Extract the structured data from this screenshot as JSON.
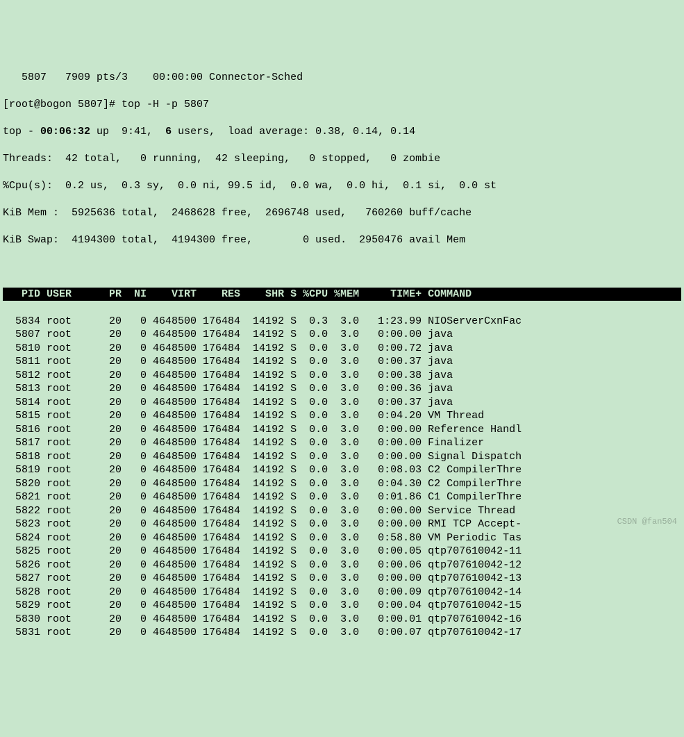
{
  "pre": {
    "ps_line": "   5807   7909 pts/3    00:00:00 Connector-Sched",
    "prompt": "[root@bogon 5807]# ",
    "command": "top -H -p 5807"
  },
  "summary": {
    "l1_a": "top - ",
    "l1_time": "00:06:32",
    "l1_b": " up  9:41,  ",
    "l1_users": "6",
    "l1_c": " users,  load average: 0.38, 0.14, 0.14",
    "l2": "Threads:  42 total,   0 running,  42 sleeping,   0 stopped,   0 zombie",
    "l3": "%Cpu(s):  0.2 us,  0.3 sy,  0.0 ni, 99.5 id,  0.0 wa,  0.0 hi,  0.1 si,  0.0 st",
    "l4": "KiB Mem :  5925636 total,  2468628 free,  2696748 used,   760260 buff/cache",
    "l5": "KiB Swap:  4194300 total,  4194300 free,        0 used.  2950476 avail Mem "
  },
  "header": "   PID USER      PR  NI    VIRT    RES    SHR S %CPU %MEM     TIME+ COMMAND         ",
  "rows": [
    {
      "pid": "5834",
      "user": "root",
      "pr": "20",
      "ni": "0",
      "virt": "4648500",
      "res": "176484",
      "shr": "14192",
      "s": "S",
      "cpu": "0.3",
      "mem": "3.0",
      "time": "1:23.99",
      "cmd": "NIOServerCxnFac"
    },
    {
      "pid": "5807",
      "user": "root",
      "pr": "20",
      "ni": "0",
      "virt": "4648500",
      "res": "176484",
      "shr": "14192",
      "s": "S",
      "cpu": "0.0",
      "mem": "3.0",
      "time": "0:00.00",
      "cmd": "java"
    },
    {
      "pid": "5810",
      "user": "root",
      "pr": "20",
      "ni": "0",
      "virt": "4648500",
      "res": "176484",
      "shr": "14192",
      "s": "S",
      "cpu": "0.0",
      "mem": "3.0",
      "time": "0:00.72",
      "cmd": "java"
    },
    {
      "pid": "5811",
      "user": "root",
      "pr": "20",
      "ni": "0",
      "virt": "4648500",
      "res": "176484",
      "shr": "14192",
      "s": "S",
      "cpu": "0.0",
      "mem": "3.0",
      "time": "0:00.37",
      "cmd": "java"
    },
    {
      "pid": "5812",
      "user": "root",
      "pr": "20",
      "ni": "0",
      "virt": "4648500",
      "res": "176484",
      "shr": "14192",
      "s": "S",
      "cpu": "0.0",
      "mem": "3.0",
      "time": "0:00.38",
      "cmd": "java"
    },
    {
      "pid": "5813",
      "user": "root",
      "pr": "20",
      "ni": "0",
      "virt": "4648500",
      "res": "176484",
      "shr": "14192",
      "s": "S",
      "cpu": "0.0",
      "mem": "3.0",
      "time": "0:00.36",
      "cmd": "java"
    },
    {
      "pid": "5814",
      "user": "root",
      "pr": "20",
      "ni": "0",
      "virt": "4648500",
      "res": "176484",
      "shr": "14192",
      "s": "S",
      "cpu": "0.0",
      "mem": "3.0",
      "time": "0:00.37",
      "cmd": "java"
    },
    {
      "pid": "5815",
      "user": "root",
      "pr": "20",
      "ni": "0",
      "virt": "4648500",
      "res": "176484",
      "shr": "14192",
      "s": "S",
      "cpu": "0.0",
      "mem": "3.0",
      "time": "0:04.20",
      "cmd": "VM Thread"
    },
    {
      "pid": "5816",
      "user": "root",
      "pr": "20",
      "ni": "0",
      "virt": "4648500",
      "res": "176484",
      "shr": "14192",
      "s": "S",
      "cpu": "0.0",
      "mem": "3.0",
      "time": "0:00.00",
      "cmd": "Reference Handl"
    },
    {
      "pid": "5817",
      "user": "root",
      "pr": "20",
      "ni": "0",
      "virt": "4648500",
      "res": "176484",
      "shr": "14192",
      "s": "S",
      "cpu": "0.0",
      "mem": "3.0",
      "time": "0:00.00",
      "cmd": "Finalizer"
    },
    {
      "pid": "5818",
      "user": "root",
      "pr": "20",
      "ni": "0",
      "virt": "4648500",
      "res": "176484",
      "shr": "14192",
      "s": "S",
      "cpu": "0.0",
      "mem": "3.0",
      "time": "0:00.00",
      "cmd": "Signal Dispatch"
    },
    {
      "pid": "5819",
      "user": "root",
      "pr": "20",
      "ni": "0",
      "virt": "4648500",
      "res": "176484",
      "shr": "14192",
      "s": "S",
      "cpu": "0.0",
      "mem": "3.0",
      "time": "0:08.03",
      "cmd": "C2 CompilerThre"
    },
    {
      "pid": "5820",
      "user": "root",
      "pr": "20",
      "ni": "0",
      "virt": "4648500",
      "res": "176484",
      "shr": "14192",
      "s": "S",
      "cpu": "0.0",
      "mem": "3.0",
      "time": "0:04.30",
      "cmd": "C2 CompilerThre"
    },
    {
      "pid": "5821",
      "user": "root",
      "pr": "20",
      "ni": "0",
      "virt": "4648500",
      "res": "176484",
      "shr": "14192",
      "s": "S",
      "cpu": "0.0",
      "mem": "3.0",
      "time": "0:01.86",
      "cmd": "C1 CompilerThre"
    },
    {
      "pid": "5822",
      "user": "root",
      "pr": "20",
      "ni": "0",
      "virt": "4648500",
      "res": "176484",
      "shr": "14192",
      "s": "S",
      "cpu": "0.0",
      "mem": "3.0",
      "time": "0:00.00",
      "cmd": "Service Thread"
    },
    {
      "pid": "5823",
      "user": "root",
      "pr": "20",
      "ni": "0",
      "virt": "4648500",
      "res": "176484",
      "shr": "14192",
      "s": "S",
      "cpu": "0.0",
      "mem": "3.0",
      "time": "0:00.00",
      "cmd": "RMI TCP Accept-"
    },
    {
      "pid": "5824",
      "user": "root",
      "pr": "20",
      "ni": "0",
      "virt": "4648500",
      "res": "176484",
      "shr": "14192",
      "s": "S",
      "cpu": "0.0",
      "mem": "3.0",
      "time": "0:58.80",
      "cmd": "VM Periodic Tas"
    },
    {
      "pid": "5825",
      "user": "root",
      "pr": "20",
      "ni": "0",
      "virt": "4648500",
      "res": "176484",
      "shr": "14192",
      "s": "S",
      "cpu": "0.0",
      "mem": "3.0",
      "time": "0:00.05",
      "cmd": "qtp707610042-11"
    },
    {
      "pid": "5826",
      "user": "root",
      "pr": "20",
      "ni": "0",
      "virt": "4648500",
      "res": "176484",
      "shr": "14192",
      "s": "S",
      "cpu": "0.0",
      "mem": "3.0",
      "time": "0:00.06",
      "cmd": "qtp707610042-12"
    },
    {
      "pid": "5827",
      "user": "root",
      "pr": "20",
      "ni": "0",
      "virt": "4648500",
      "res": "176484",
      "shr": "14192",
      "s": "S",
      "cpu": "0.0",
      "mem": "3.0",
      "time": "0:00.00",
      "cmd": "qtp707610042-13"
    },
    {
      "pid": "5828",
      "user": "root",
      "pr": "20",
      "ni": "0",
      "virt": "4648500",
      "res": "176484",
      "shr": "14192",
      "s": "S",
      "cpu": "0.0",
      "mem": "3.0",
      "time": "0:00.09",
      "cmd": "qtp707610042-14"
    },
    {
      "pid": "5829",
      "user": "root",
      "pr": "20",
      "ni": "0",
      "virt": "4648500",
      "res": "176484",
      "shr": "14192",
      "s": "S",
      "cpu": "0.0",
      "mem": "3.0",
      "time": "0:00.04",
      "cmd": "qtp707610042-15"
    },
    {
      "pid": "5830",
      "user": "root",
      "pr": "20",
      "ni": "0",
      "virt": "4648500",
      "res": "176484",
      "shr": "14192",
      "s": "S",
      "cpu": "0.0",
      "mem": "3.0",
      "time": "0:00.01",
      "cmd": "qtp707610042-16"
    },
    {
      "pid": "5831",
      "user": "root",
      "pr": "20",
      "ni": "0",
      "virt": "4648500",
      "res": "176484",
      "shr": "14192",
      "s": "S",
      "cpu": "0.0",
      "mem": "3.0",
      "time": "0:00.07",
      "cmd": "qtp707610042-17"
    }
  ],
  "watermark": "CSDN @fan504"
}
